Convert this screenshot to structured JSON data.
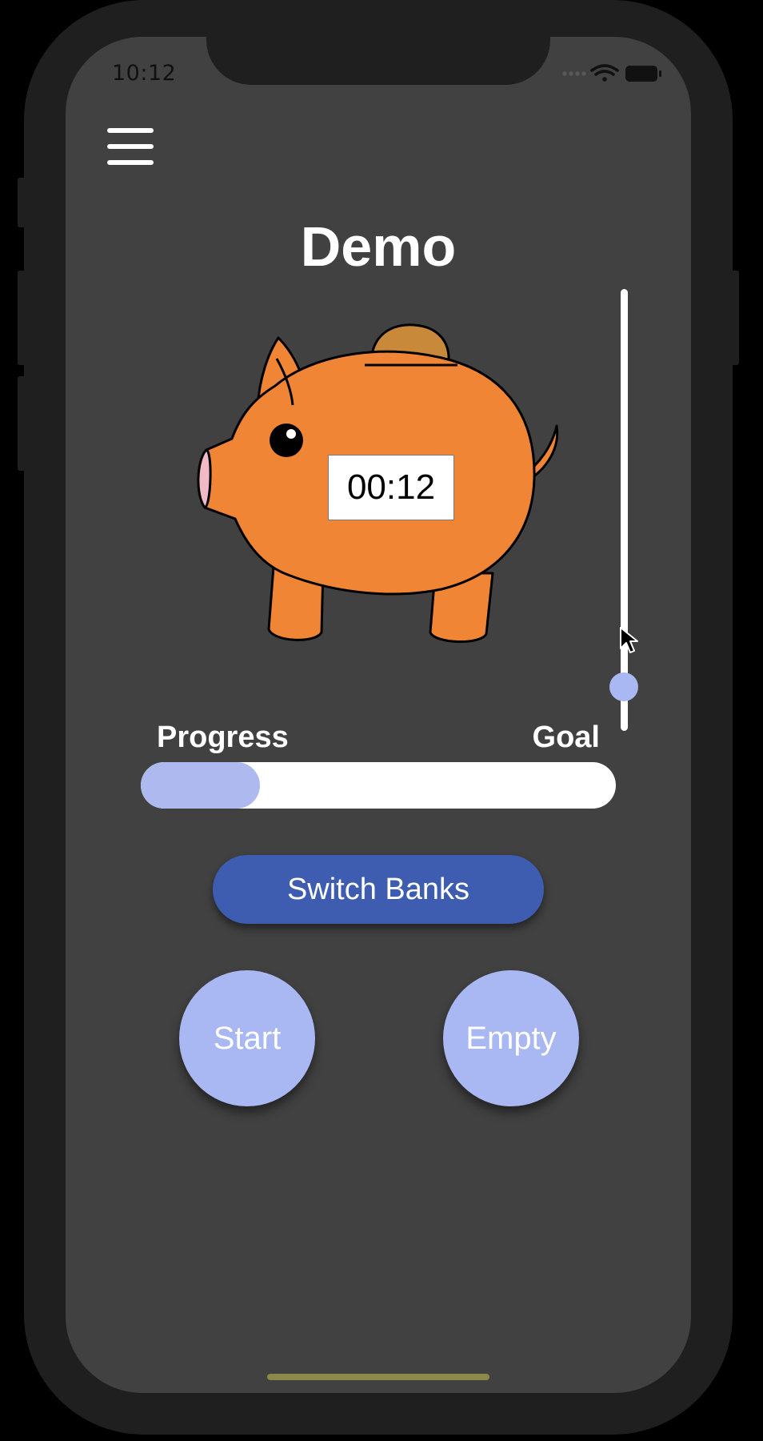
{
  "status_bar": {
    "time": "10:12",
    "icons": [
      "signal-dots-icon",
      "wifi-icon",
      "battery-icon"
    ]
  },
  "menu": {
    "icon": "hamburger-menu-icon"
  },
  "page": {
    "title": "Demo"
  },
  "piggy_bank": {
    "icon": "piggy-bank-icon",
    "timer": "00:12"
  },
  "slider": {
    "value": 0.9
  },
  "progress": {
    "label": "Progress",
    "goal_label": "Goal",
    "value": 0.25
  },
  "actions": {
    "switch_banks": "Switch Banks",
    "start": "Start",
    "empty": "Empty"
  },
  "colors": {
    "background": "#414141",
    "pig_body": "#ef8535",
    "coin": "#c8893a",
    "accent_blue": "#3e5db0",
    "light_blue": "#a9b7f3",
    "progress_fill": "#aeb9ef"
  }
}
